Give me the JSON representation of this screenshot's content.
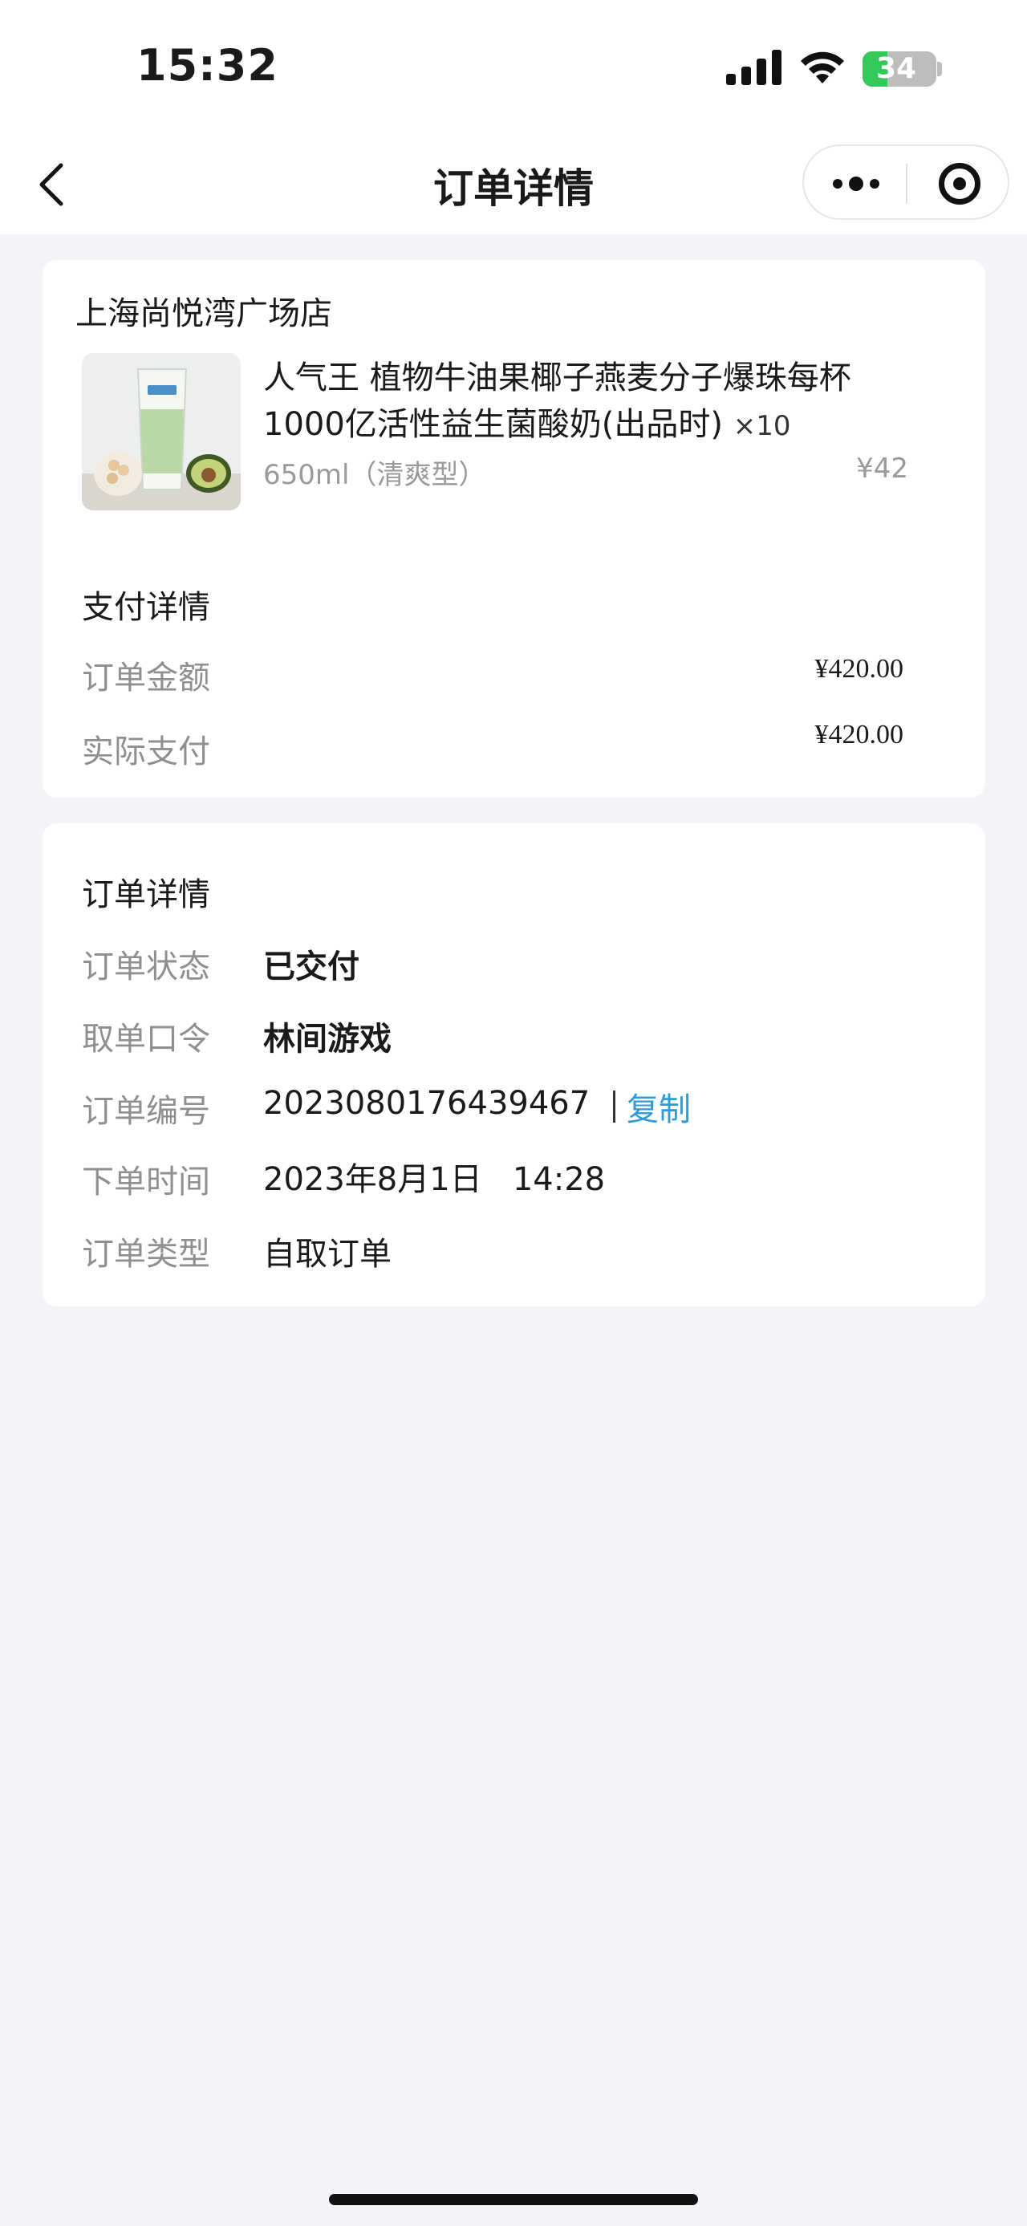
{
  "status_bar": {
    "time": "15:32",
    "battery": "34"
  },
  "nav": {
    "title": "订单详情"
  },
  "order": {
    "store_name": "上海尚悦湾广场店",
    "product": {
      "name": "人气王 植物牛油果椰子燕麦分子爆珠每杯1000亿活性益生菌酸奶(出品时)",
      "qty": "×10",
      "spec": "650ml（清爽型）",
      "price": "¥42"
    },
    "payment": {
      "title": "支付详情",
      "order_amount_label": "订单金额",
      "order_amount": "¥420.00",
      "paid_label": "实际支付",
      "paid": "¥420.00"
    },
    "details": {
      "title": "订单详情",
      "status_label": "订单状态",
      "status": "已交付",
      "pickup_label": "取单口令",
      "pickup_code": "林间游戏",
      "number_label": "订单编号",
      "number": "2023080176439467",
      "copy_label": "复制",
      "time_label": "下单时间",
      "time": "2023年8月1日   14:28",
      "type_label": "订单类型",
      "type": "自取订单"
    }
  },
  "colors": {
    "accent_link": "#2f9bd6",
    "background": "#f3f4f8",
    "battery_green": "#34c759"
  }
}
